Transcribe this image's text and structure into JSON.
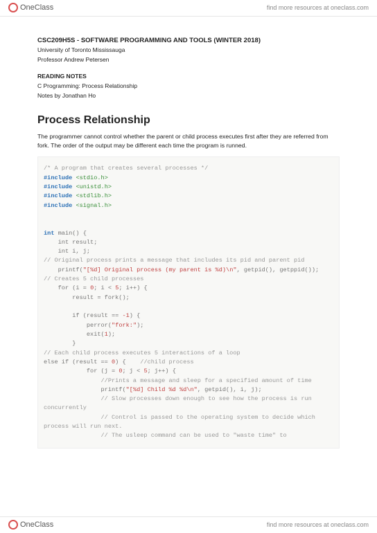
{
  "brand": {
    "name": "OneClass",
    "tagline": "find more resources at oneclass.com"
  },
  "header": {
    "course_line": "CSC209H5S - SOFTWARE PROGRAMMING AND TOOLS (WINTER 2018)",
    "university": "University of Toronto Mississauga",
    "professor": "Professor Andrew Petersen",
    "reading_head": "READING NOTES",
    "topic": "C Programming: Process Relationship",
    "author": "Notes by Jonathan Ho"
  },
  "section": {
    "title": "Process Relationship",
    "para": "The programmer cannot control whether the parent or child process executes first after they are referred from fork. The order of the output may be different each time the program is runned."
  },
  "code": {
    "c01": "/* A program that creates several processes */",
    "inc1a": "#include",
    "inc1b": "<stdio.h>",
    "inc2a": "#include",
    "inc2b": "<unistd.h>",
    "inc3a": "#include",
    "inc3b": "<stdlib.h>",
    "inc4a": "#include",
    "inc4b": "<signal.h>",
    "l_int": "int",
    "l_main": " main() {",
    "l_res": "    int result;",
    "l_ij": "    int i, j;",
    "c02": "// Original process prints a message that includes its pid and parent pid",
    "l_pf1a": "    printf(",
    "l_pf1b": "\"[%d] Original process (my parent is %d)\\n\"",
    "l_pf1c": ", getpid(), getppid());",
    "c03": "// Creates 5 child processes",
    "l_for1a": "    for (i = ",
    "n0a": "0",
    "l_for1b": "; i < ",
    "n5a": "5",
    "l_for1c": "; i++) {",
    "l_fork": "        result = fork();",
    "l_if1a": "        if (result == ",
    "nNeg1": "-1",
    "l_if1b": ") {",
    "l_perra": "            perror(",
    "l_perrb": "\"fork:\"",
    "l_perrc": ");",
    "l_exita": "            exit(",
    "n1": "1",
    "l_exitb": ");",
    "l_cb1": "        }",
    "c04": "// Each child process executes 5 interactions of a loop",
    "l_elifa": "else if (result == ",
    "n0b": "0",
    "l_elifb": ") {    ",
    "c_child": "//child process",
    "l_for2a": "            for (j = ",
    "n0c": "0",
    "l_for2b": "; j < ",
    "n5b": "5",
    "l_for2c": "; j++) {",
    "c05": "                //Prints a message and sleep for a specified amount of time",
    "l_pf2a": "                printf(",
    "l_pf2b": "\"[%d] Child %d %d\\n\"",
    "l_pf2c": ", getpid(), i, j);",
    "c06": "                // Slow processes down enough to see how the process is run concurrently",
    "c07": "                // Control is passed to the operating system to decide which process will run next.",
    "c08": "                // The usleep command can be used to \"waste time\" to"
  }
}
